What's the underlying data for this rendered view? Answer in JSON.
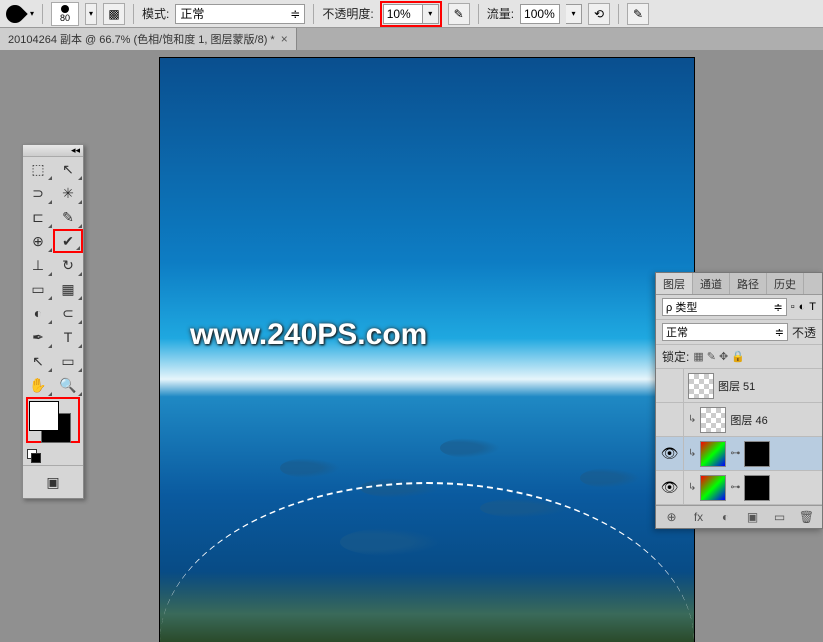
{
  "options_bar": {
    "brush_size": "80",
    "mode_label": "模式:",
    "mode_value": "正常",
    "opacity_label": "不透明度:",
    "opacity_value": "10%",
    "flow_label": "流量:",
    "flow_value": "100%"
  },
  "document_tab": {
    "title": "20104264 副本 @ 66.7% (色相/饱和度 1, 图层蒙版/8) *",
    "close": "×"
  },
  "watermark": "www.240PS.com",
  "tools": [
    {
      "name": "move-tool",
      "glyph": "⬚"
    },
    {
      "name": "arrow-tool",
      "glyph": "↖"
    },
    {
      "name": "lasso-tool",
      "glyph": "⊃"
    },
    {
      "name": "magic-wand-tool",
      "glyph": "✳"
    },
    {
      "name": "crop-tool",
      "glyph": "⊏"
    },
    {
      "name": "eyedropper-tool",
      "glyph": "✎"
    },
    {
      "name": "patch-tool",
      "glyph": "⊕"
    },
    {
      "name": "brush-tool",
      "glyph": "✔",
      "highlight": true
    },
    {
      "name": "stamp-tool",
      "glyph": "⊥"
    },
    {
      "name": "history-brush-tool",
      "glyph": "↻"
    },
    {
      "name": "eraser-tool",
      "glyph": "▭"
    },
    {
      "name": "gradient-tool",
      "glyph": "▦"
    },
    {
      "name": "blur-tool",
      "glyph": "◐"
    },
    {
      "name": "dodge-tool",
      "glyph": "⊂"
    },
    {
      "name": "pen-tool",
      "glyph": "✒"
    },
    {
      "name": "type-tool",
      "glyph": "T"
    },
    {
      "name": "path-select-tool",
      "glyph": "↖"
    },
    {
      "name": "shape-tool",
      "glyph": "▭"
    },
    {
      "name": "hand-tool",
      "glyph": "✋"
    },
    {
      "name": "zoom-tool",
      "glyph": "🔍"
    }
  ],
  "layers_panel": {
    "tabs": [
      "图层",
      "通道",
      "路径",
      "历史"
    ],
    "kind_label": "ρ 类型",
    "blend_mode": "正常",
    "opacity_short": "不透",
    "lock_label": "锁定:",
    "layers": [
      {
        "visible": false,
        "name": "图层 51",
        "thumb": "checker"
      },
      {
        "visible": false,
        "name": "图层 46",
        "thumb": "checker",
        "clipped": true
      },
      {
        "visible": true,
        "name": "",
        "thumb": "adj",
        "mask": "black",
        "clipped": true,
        "selected": true
      },
      {
        "visible": true,
        "name": "",
        "thumb": "adj",
        "mask": "black",
        "clipped": true
      }
    ],
    "footer_icons": [
      "⊕",
      "fx",
      "◐",
      "▣",
      "▭",
      "🗑"
    ]
  }
}
